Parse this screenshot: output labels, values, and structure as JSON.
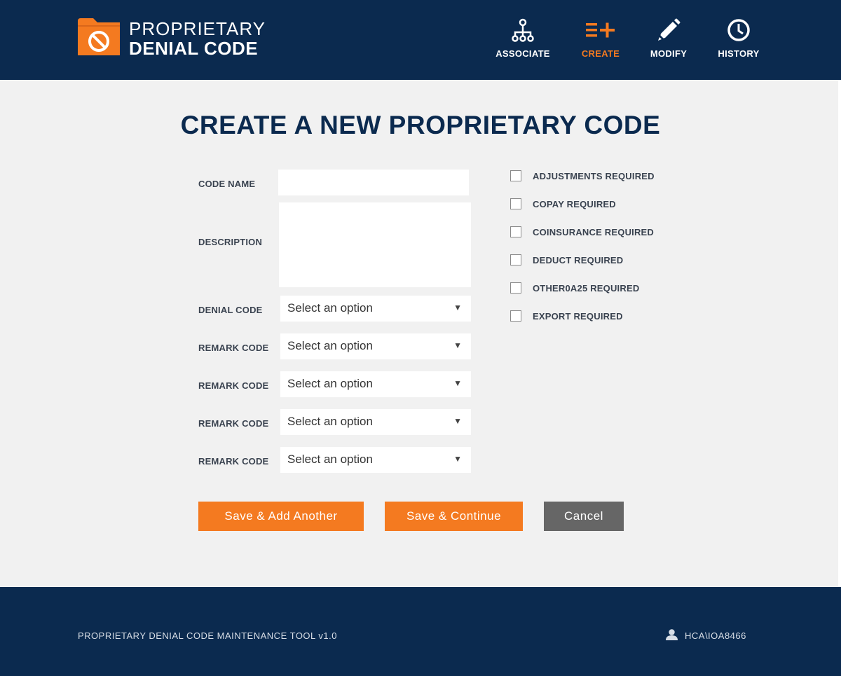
{
  "colors": {
    "navy": "#0b2a4f",
    "accent": "#f47a20",
    "gray_button": "#666666",
    "background": "#f1f1f1"
  },
  "header": {
    "logo": {
      "icon": "folder-ban-icon",
      "line1": "PROPRIETARY",
      "line2": "DENIAL CODE"
    },
    "nav": [
      {
        "label": "ASSOCIATE",
        "icon": "hierarchy-icon",
        "active": false
      },
      {
        "label": "CREATE",
        "icon": "list-plus-icon",
        "active": true
      },
      {
        "label": "MODIFY",
        "icon": "pencil-icon",
        "active": false
      },
      {
        "label": "HISTORY",
        "icon": "clock-icon",
        "active": false
      }
    ]
  },
  "main": {
    "title": "CREATE A NEW PROPRIETARY CODE",
    "form": {
      "code_name": {
        "label": "CODE NAME",
        "value": ""
      },
      "description": {
        "label": "DESCRIPTION",
        "value": ""
      },
      "selects": [
        {
          "label": "DENIAL CODE",
          "value": "Select an option"
        },
        {
          "label": "REMARK CODE",
          "value": "Select an option"
        },
        {
          "label": "REMARK CODE",
          "value": "Select an option"
        },
        {
          "label": "REMARK CODE",
          "value": "Select an option"
        },
        {
          "label": "REMARK CODE",
          "value": "Select an option"
        }
      ],
      "checkboxes": [
        {
          "label": "ADJUSTMENTS REQUIRED",
          "checked": false
        },
        {
          "label": "COPAY REQUIRED",
          "checked": false
        },
        {
          "label": "COINSURANCE REQUIRED",
          "checked": false
        },
        {
          "label": "DEDUCT REQUIRED",
          "checked": false
        },
        {
          "label": "OTHER0A25 REQUIRED",
          "checked": false
        },
        {
          "label": "EXPORT REQUIRED",
          "checked": false
        }
      ]
    },
    "buttons": {
      "save_add": "Save & Add Another",
      "save_continue": "Save & Continue",
      "cancel": "Cancel"
    }
  },
  "footer": {
    "tool_name": "PROPRIETARY DENIAL CODE MAINTENANCE TOOL v1.0",
    "user": "HCA\\IOA8466",
    "user_icon": "user-icon"
  }
}
